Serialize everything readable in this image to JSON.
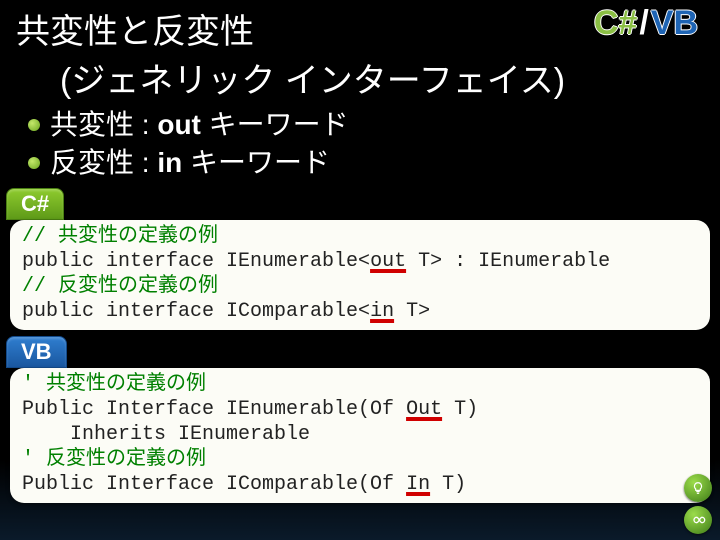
{
  "header": {
    "title1": "共変性と反変性",
    "title2": "(ジェネリック インターフェイス)",
    "cs_label": "C#",
    "slash": "/",
    "vb_label": "VB"
  },
  "bullets": {
    "b1_pre": "共変性 : ",
    "b1_kw": "out",
    "b1_post": " キーワード",
    "b2_pre": "反変性 : ",
    "b2_kw": "in",
    "b2_post": " キーワード"
  },
  "cs_tab": "C#",
  "cs_code": {
    "l1": "// 共変性の定義の例",
    "l2a": "public interface IEnumerable<",
    "l2b": "out",
    "l2c": " T> : IEnumerable",
    "l3": "// 反変性の定義の例",
    "l4a": "public interface IComparable<",
    "l4b": "in",
    "l4c": " T>"
  },
  "vb_tab": "VB",
  "vb_code": {
    "l1": "' 共変性の定義の例",
    "l2a": "Public Interface IEnumerable(Of ",
    "l2b": "Out",
    "l2c": " T)",
    "l3": "    Inherits IEnumerable",
    "l4": "' 反変性の定義の例",
    "l5a": "Public Interface IComparable(Of ",
    "l5b": "In",
    "l5c": " T)"
  }
}
